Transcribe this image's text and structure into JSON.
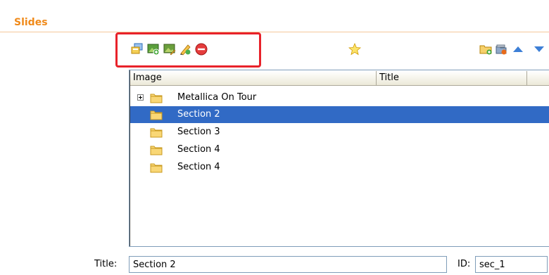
{
  "section": {
    "title": "Slides"
  },
  "toolbar": {
    "left_icons": [
      "add-slide-icon",
      "add-image-icon",
      "edit-image-icon",
      "edit-pencil-icon",
      "delete-icon"
    ],
    "center_icons": [
      "favorite-star-icon"
    ],
    "right_icons": [
      "add-folder-icon",
      "folder-settings-icon",
      "move-up-icon",
      "move-down-icon"
    ],
    "highlight_color": "#e8222a"
  },
  "tree": {
    "columns": [
      "Image",
      "Title"
    ],
    "rows": [
      {
        "label": "Metallica On Tour",
        "expandable": true,
        "selected": false
      },
      {
        "label": "Section 2",
        "expandable": false,
        "selected": true
      },
      {
        "label": "Section 3",
        "expandable": false,
        "selected": false
      },
      {
        "label": "Section 4",
        "expandable": false,
        "selected": false
      },
      {
        "label": "Section 4",
        "expandable": false,
        "selected": false
      }
    ],
    "selection_color": "#316ac5"
  },
  "form": {
    "title_label": "Title:",
    "title_value": "Section 2",
    "id_label": "ID:",
    "id_value": "sec_1"
  },
  "colors": {
    "accent": "#f08a1a"
  }
}
